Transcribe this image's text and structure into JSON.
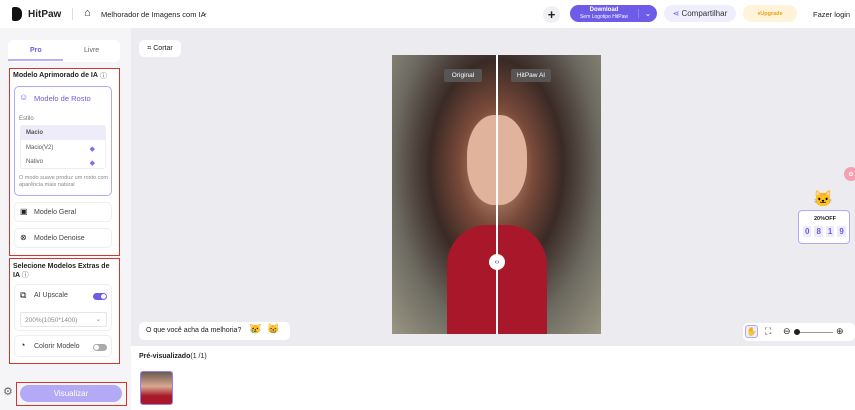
{
  "header": {
    "brand": "HitPaw",
    "tool": "Melhorador de Imagens com IA",
    "download": "Download",
    "download_sub": "Sem Logotipo HitPaw",
    "share": "Compartilhar",
    "upgrade": "Upgrade",
    "login": "Fazer login"
  },
  "left": {
    "tabs": [
      "Pro",
      "Livre"
    ],
    "section1": "Modelo Aprimorado de IA",
    "face_model": "Modelo de Rosto",
    "style_label": "Estilo",
    "styles": [
      "Macio",
      "Macio(V2)",
      "Nativo"
    ],
    "style_desc": "O modo suave produz um rosto com aparência mais natural",
    "general_model": "Modelo Geral",
    "denoise_model": "Modelo Denoise",
    "section2": "Selecione Modelos Extras de IA",
    "upscale": "AI Upscale",
    "upscale_on": true,
    "scale_value": "200%(1050*1400)",
    "colorize": "Colorir Modelo",
    "colorize_on": false,
    "preview_btn": "Visualizar"
  },
  "main": {
    "crop": "Cortar",
    "label_original": "Original",
    "label_ai": "HitPaw AI",
    "feedback": "O que você acha da melhoria?",
    "promo_discount": "20%OFF",
    "promo_timer": [
      "0",
      "8",
      "1",
      "9"
    ],
    "preview_title": "Pré-visualizado",
    "preview_count": "(1 /1)"
  }
}
